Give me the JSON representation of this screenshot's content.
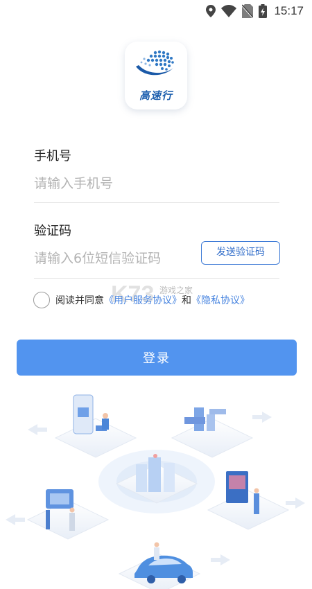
{
  "status_bar": {
    "time": "15:17",
    "icons": [
      "location-icon",
      "wifi-icon",
      "no-sim-icon",
      "battery-charging-icon"
    ]
  },
  "logo": {
    "text": "高速行",
    "icon": "globe-logo-icon",
    "brand_color": "#1d5fae"
  },
  "form": {
    "phone": {
      "label": "手机号",
      "placeholder": "请输入手机号",
      "value": ""
    },
    "code": {
      "label": "验证码",
      "placeholder": "请输入6位短信验证码",
      "value": "",
      "send_button_label": "发送验证码"
    },
    "agreement": {
      "prefix": "阅读并同意",
      "service_link": "《用户服务协议》",
      "and": "和",
      "privacy_link": "《隐私协议》",
      "checked": false
    },
    "login_button_label": "登录"
  },
  "watermark": {
    "text": "游戏之家"
  },
  "colors": {
    "accent": "#5294ef",
    "link": "#4a86e0",
    "send_border": "#3d7ad6"
  },
  "illustration": {
    "icon": "smart-city-illustration"
  }
}
